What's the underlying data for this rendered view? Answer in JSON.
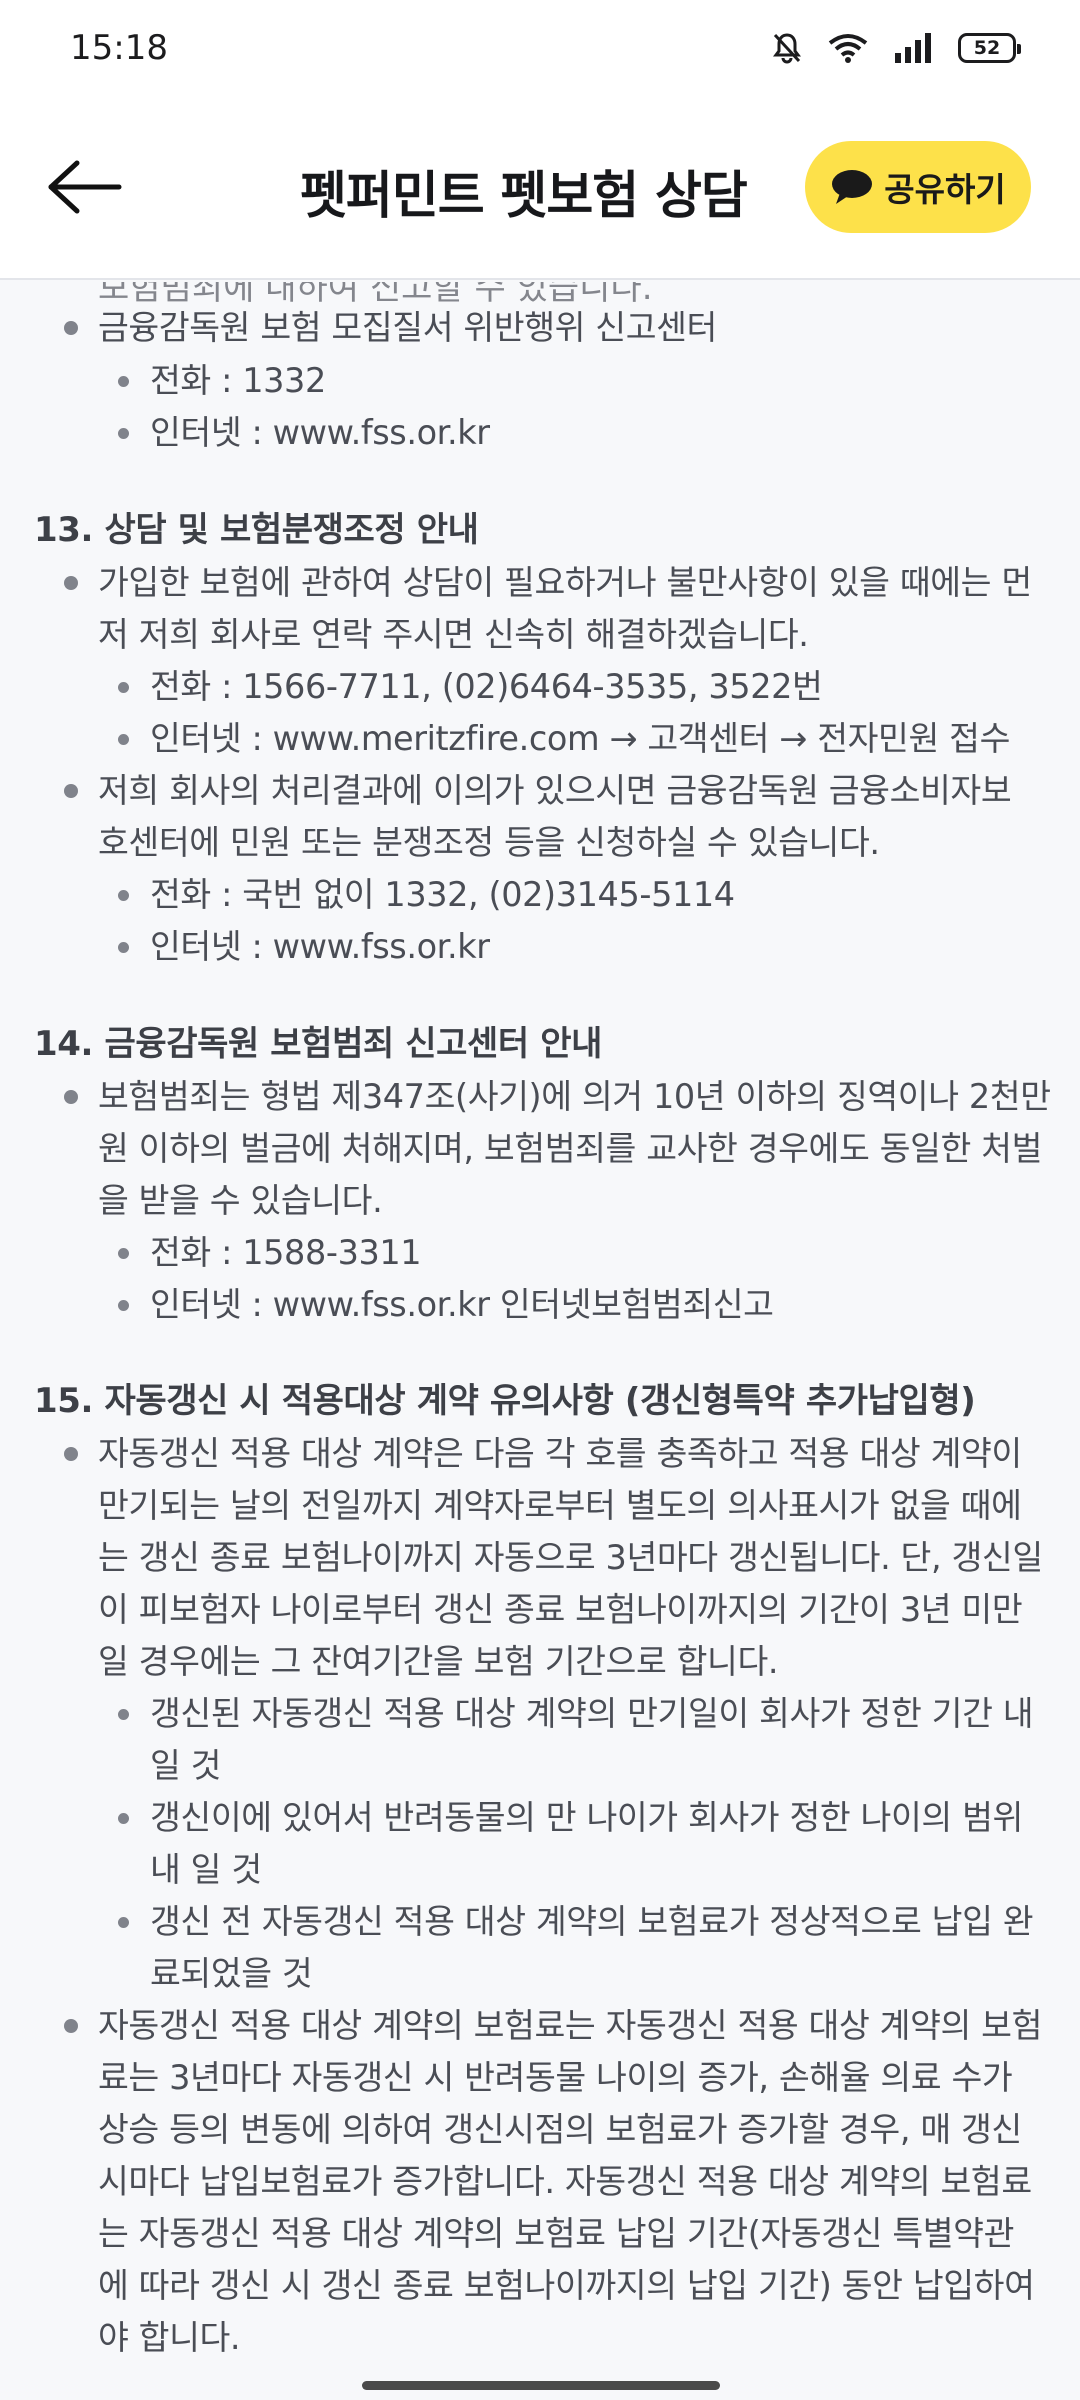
{
  "status_bar": {
    "time": "15:18",
    "battery": "52"
  },
  "header": {
    "title": "펫퍼민트 펫보험 상담",
    "share_label": "공유하기"
  },
  "content": {
    "clipped_line": "보험범죄에 대하여 신고할 수 있습니다.",
    "s12_bullet": "금융감독원 보험 모집질서 위반행위 신고센터",
    "s12_phone": "전화 : 1332",
    "s12_web": "인터넷 : www.fss.or.kr",
    "s13_title": "13. 상담 및 보험분쟁조정 안내",
    "s13_b1_l1": "가입한 보험에 관하여 상담이 필요하거나 불만사항이 있을 때에는 먼",
    "s13_b1_l2": "저 저희 회사로 연락 주시면 신속히 해결하겠습니다.",
    "s13_b1_phone": "전화 : 1566-7711, (02)6464-3535, 3522번",
    "s13_b1_web": "인터넷 : www.meritzfire.com → 고객센터 → 전자민원 접수",
    "s13_b2_l1": "저희 회사의 처리결과에 이의가 있으시면 금융감독원 금융소비자보",
    "s13_b2_l2": "호센터에 민원 또는 분쟁조정 등을 신청하실 수 있습니다.",
    "s13_b2_phone": "전화 : 국번 없이 1332, (02)3145-5114",
    "s13_b2_web": "인터넷 : www.fss.or.kr",
    "s14_title": "14. 금융감독원 보험범죄 신고센터 안내",
    "s14_b1_l1": "보험범죄는 형법 제347조(사기)에 의거 10년 이하의 징역이나 2천만",
    "s14_b1_l2": "원 이하의 벌금에 처해지며, 보험범죄를 교사한 경우에도 동일한 처벌",
    "s14_b1_l3": "을 받을 수 있습니다.",
    "s14_phone": "전화 : 1588-3311",
    "s14_web": "인터넷 : www.fss.or.kr 인터넷보험범죄신고",
    "s15_title": "15. 자동갱신 시 적용대상 계약 유의사항 (갱신형특약 추가납입형)",
    "s15_b1_l1": "자동갱신 적용 대상 계약은 다음 각 호를 충족하고 적용 대상 계약이",
    "s15_b1_l2": "만기되는 날의 전일까지 계약자로부터 별도의 의사표시가 없을 때에",
    "s15_b1_l3": "는 갱신 종료 보험나이까지 자동으로 3년마다 갱신됩니다. 단, 갱신일",
    "s15_b1_l4": "이 피보험자 나이로부터 갱신 종료 보험나이까지의 기간이 3년 미만",
    "s15_b1_l5": "일 경우에는 그 잔여기간을 보험 기간으로 합니다.",
    "s15_sub1_l1": "갱신된 자동갱신 적용 대상 계약의 만기일이 회사가 정한 기간 내",
    "s15_sub1_l2": "일 것",
    "s15_sub2_l1": "갱신이에 있어서 반려동물의 만 나이가 회사가 정한 나이의 범위",
    "s15_sub2_l2": "내 일 것",
    "s15_sub3_l1": "갱신 전 자동갱신 적용 대상 계약의 보험료가 정상적으로 납입 완",
    "s15_sub3_l2": "료되었을 것",
    "s15_b2_l1": "자동갱신 적용 대상 계약의 보험료는 자동갱신 적용 대상 계약의 보험",
    "s15_b2_l2": "료는 3년마다 자동갱신 시 반려동물 나이의 증가, 손해율 의료 수가",
    "s15_b2_l3": "상승 등의 변동에 의하여 갱신시점의 보험료가 증가할 경우, 매 갱신",
    "s15_b2_l4": "시마다 납입보험료가 증가합니다. 자동갱신 적용 대상 계약의 보험료",
    "s15_b2_l5": "는 자동갱신 적용 대상 계약의 보험료 납입 기간(자동갱신 특별약관",
    "s15_b2_l6": "에 따라 갱신 시 갱신 종료 보험나이까지의 납입 기간) 동안 납입하여",
    "s15_b2_l7": "야 합니다."
  }
}
